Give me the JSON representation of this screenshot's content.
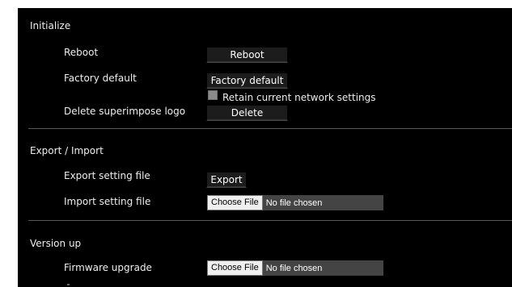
{
  "initialize": {
    "title": "Initialize",
    "reboot": {
      "label": "Reboot",
      "button": "Reboot"
    },
    "factory_default": {
      "label": "Factory default",
      "button": "Factory default",
      "retain_checkbox_label": "Retain current network settings",
      "retain_checked": false
    },
    "delete_logo": {
      "label": "Delete superimpose logo",
      "button": "Delete"
    }
  },
  "export_import": {
    "title": "Export / Import",
    "export": {
      "label": "Export setting file",
      "button": "Export"
    },
    "import": {
      "label": "Import setting file",
      "choose_button": "Choose File",
      "status": "No file chosen"
    }
  },
  "version_up": {
    "title": "Version up",
    "firmware": {
      "label": "Firmware upgrade",
      "choose_button": "Choose File",
      "status": "No file chosen"
    }
  },
  "colors": {
    "panel_background": "#000000",
    "text": "#eeeeee",
    "divider": "#5a5a5a",
    "button_background": "#1c1c1c",
    "file_field_background": "#444444"
  }
}
